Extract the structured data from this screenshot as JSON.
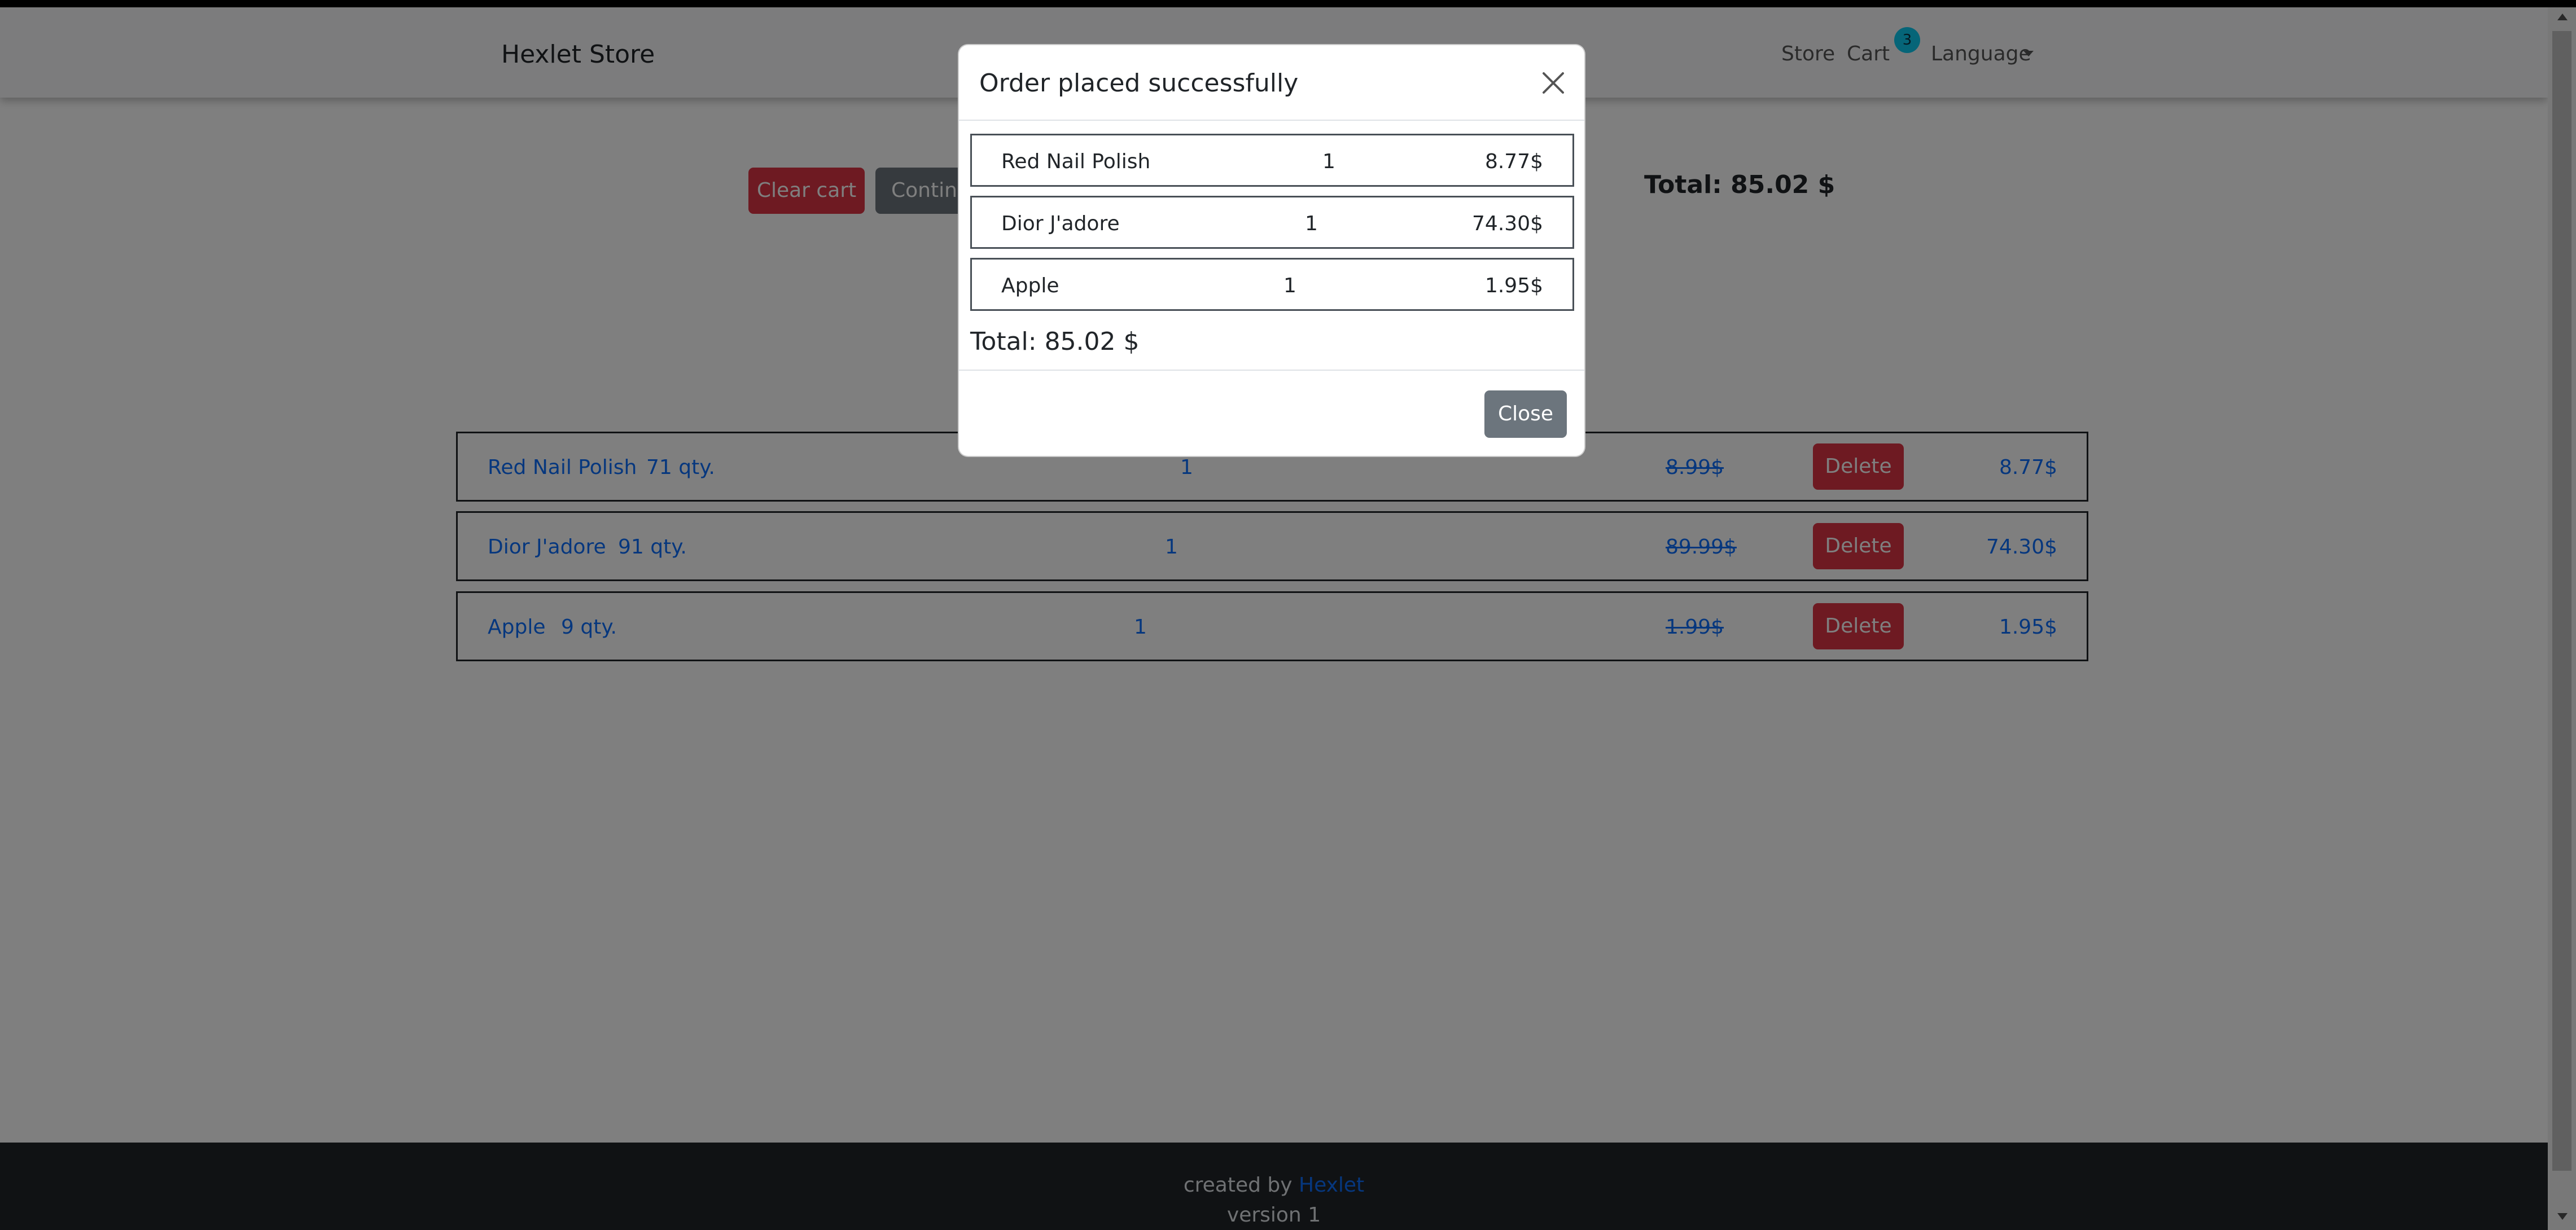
{
  "navbar": {
    "brand": "Hexlet Store",
    "store_link": "Store",
    "cart_link": "Cart",
    "cart_count": "3",
    "language_label": "Language"
  },
  "cart_actions": {
    "clear_label": "Clear cart",
    "continue_label": "Continue",
    "total_text": "Total: 85.02 $"
  },
  "cart_items": [
    {
      "name": "Red Nail Polish",
      "stock": "71 qty.",
      "count": "1",
      "old_price": "8.99$",
      "delete_label": "Delete",
      "price": "8.77$"
    },
    {
      "name": "Dior J'adore",
      "stock": "91 qty.",
      "count": "1",
      "old_price": "89.99$",
      "delete_label": "Delete",
      "price": "74.30$"
    },
    {
      "name": "Apple",
      "stock": "9 qty.",
      "count": "1",
      "old_price": "1.99$",
      "delete_label": "Delete",
      "price": "1.95$"
    }
  ],
  "modal": {
    "title": "Order placed successfully",
    "items": [
      {
        "name": "Red Nail Polish",
        "count": "1",
        "price": "8.77$"
      },
      {
        "name": "Dior J'adore",
        "count": "1",
        "price": "74.30$"
      },
      {
        "name": "Apple",
        "count": "1",
        "price": "1.95$"
      }
    ],
    "total_text": "Total: 85.02 $",
    "close_label": "Close"
  },
  "footer": {
    "created_by": "created by",
    "author_link": "Hexlet",
    "version": "version 1"
  },
  "colors": {
    "danger": "#dc3545",
    "secondary": "#6c757d",
    "link": "#0d6efd",
    "badge": "#0dcaf0",
    "footer_bg": "#212529"
  }
}
